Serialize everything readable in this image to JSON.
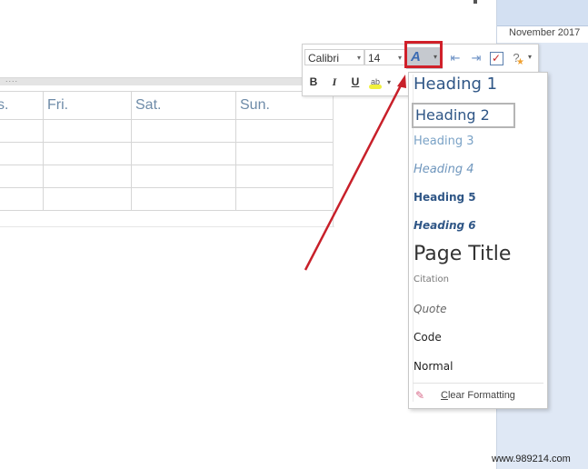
{
  "page_pane": {
    "date": "November 2017"
  },
  "table": {
    "headers": [
      "s.",
      "Fri.",
      "Sat.",
      "Sun."
    ],
    "rows": [
      [
        "",
        "",
        "",
        ""
      ],
      [
        "",
        "",
        "",
        ""
      ],
      [
        "",
        "",
        "",
        ""
      ],
      [
        "",
        "",
        "",
        ""
      ]
    ],
    "handle_dots": "...."
  },
  "mini_toolbar": {
    "font_name": "Calibri",
    "font_size": "14",
    "styles_icon": "styles-icon",
    "styles_glyph": "A",
    "decrease_indent_icon": "decrease-indent-icon",
    "increase_indent_icon": "increase-indent-icon",
    "todo_tag_icon": "checkbox-icon",
    "tag_icon": "tag-star-icon",
    "bold_label": "B",
    "italic_label": "I",
    "underline_label": "U",
    "highlight_label": "ab",
    "highlight_color": "#f0f03c",
    "dropdown_arrow": "▾"
  },
  "styles_menu": {
    "items": [
      {
        "label": "Heading 1"
      },
      {
        "label": "Heading 2",
        "selected": true
      },
      {
        "label": "Heading 3"
      },
      {
        "label": "Heading 4"
      },
      {
        "label": "Heading 5"
      },
      {
        "label": "Heading 6"
      },
      {
        "label": "Page Title"
      },
      {
        "label": "Citation"
      },
      {
        "label": "Quote"
      },
      {
        "label": "Code"
      },
      {
        "label": "Normal"
      }
    ],
    "clear_formatting": {
      "accel": "C",
      "rest": "lear Formatting",
      "icon": "eraser-icon"
    }
  },
  "annotation": {
    "highlight_color": "#d0202a",
    "arrow_color": "#c8202a"
  },
  "watermark": "www.989214.com"
}
